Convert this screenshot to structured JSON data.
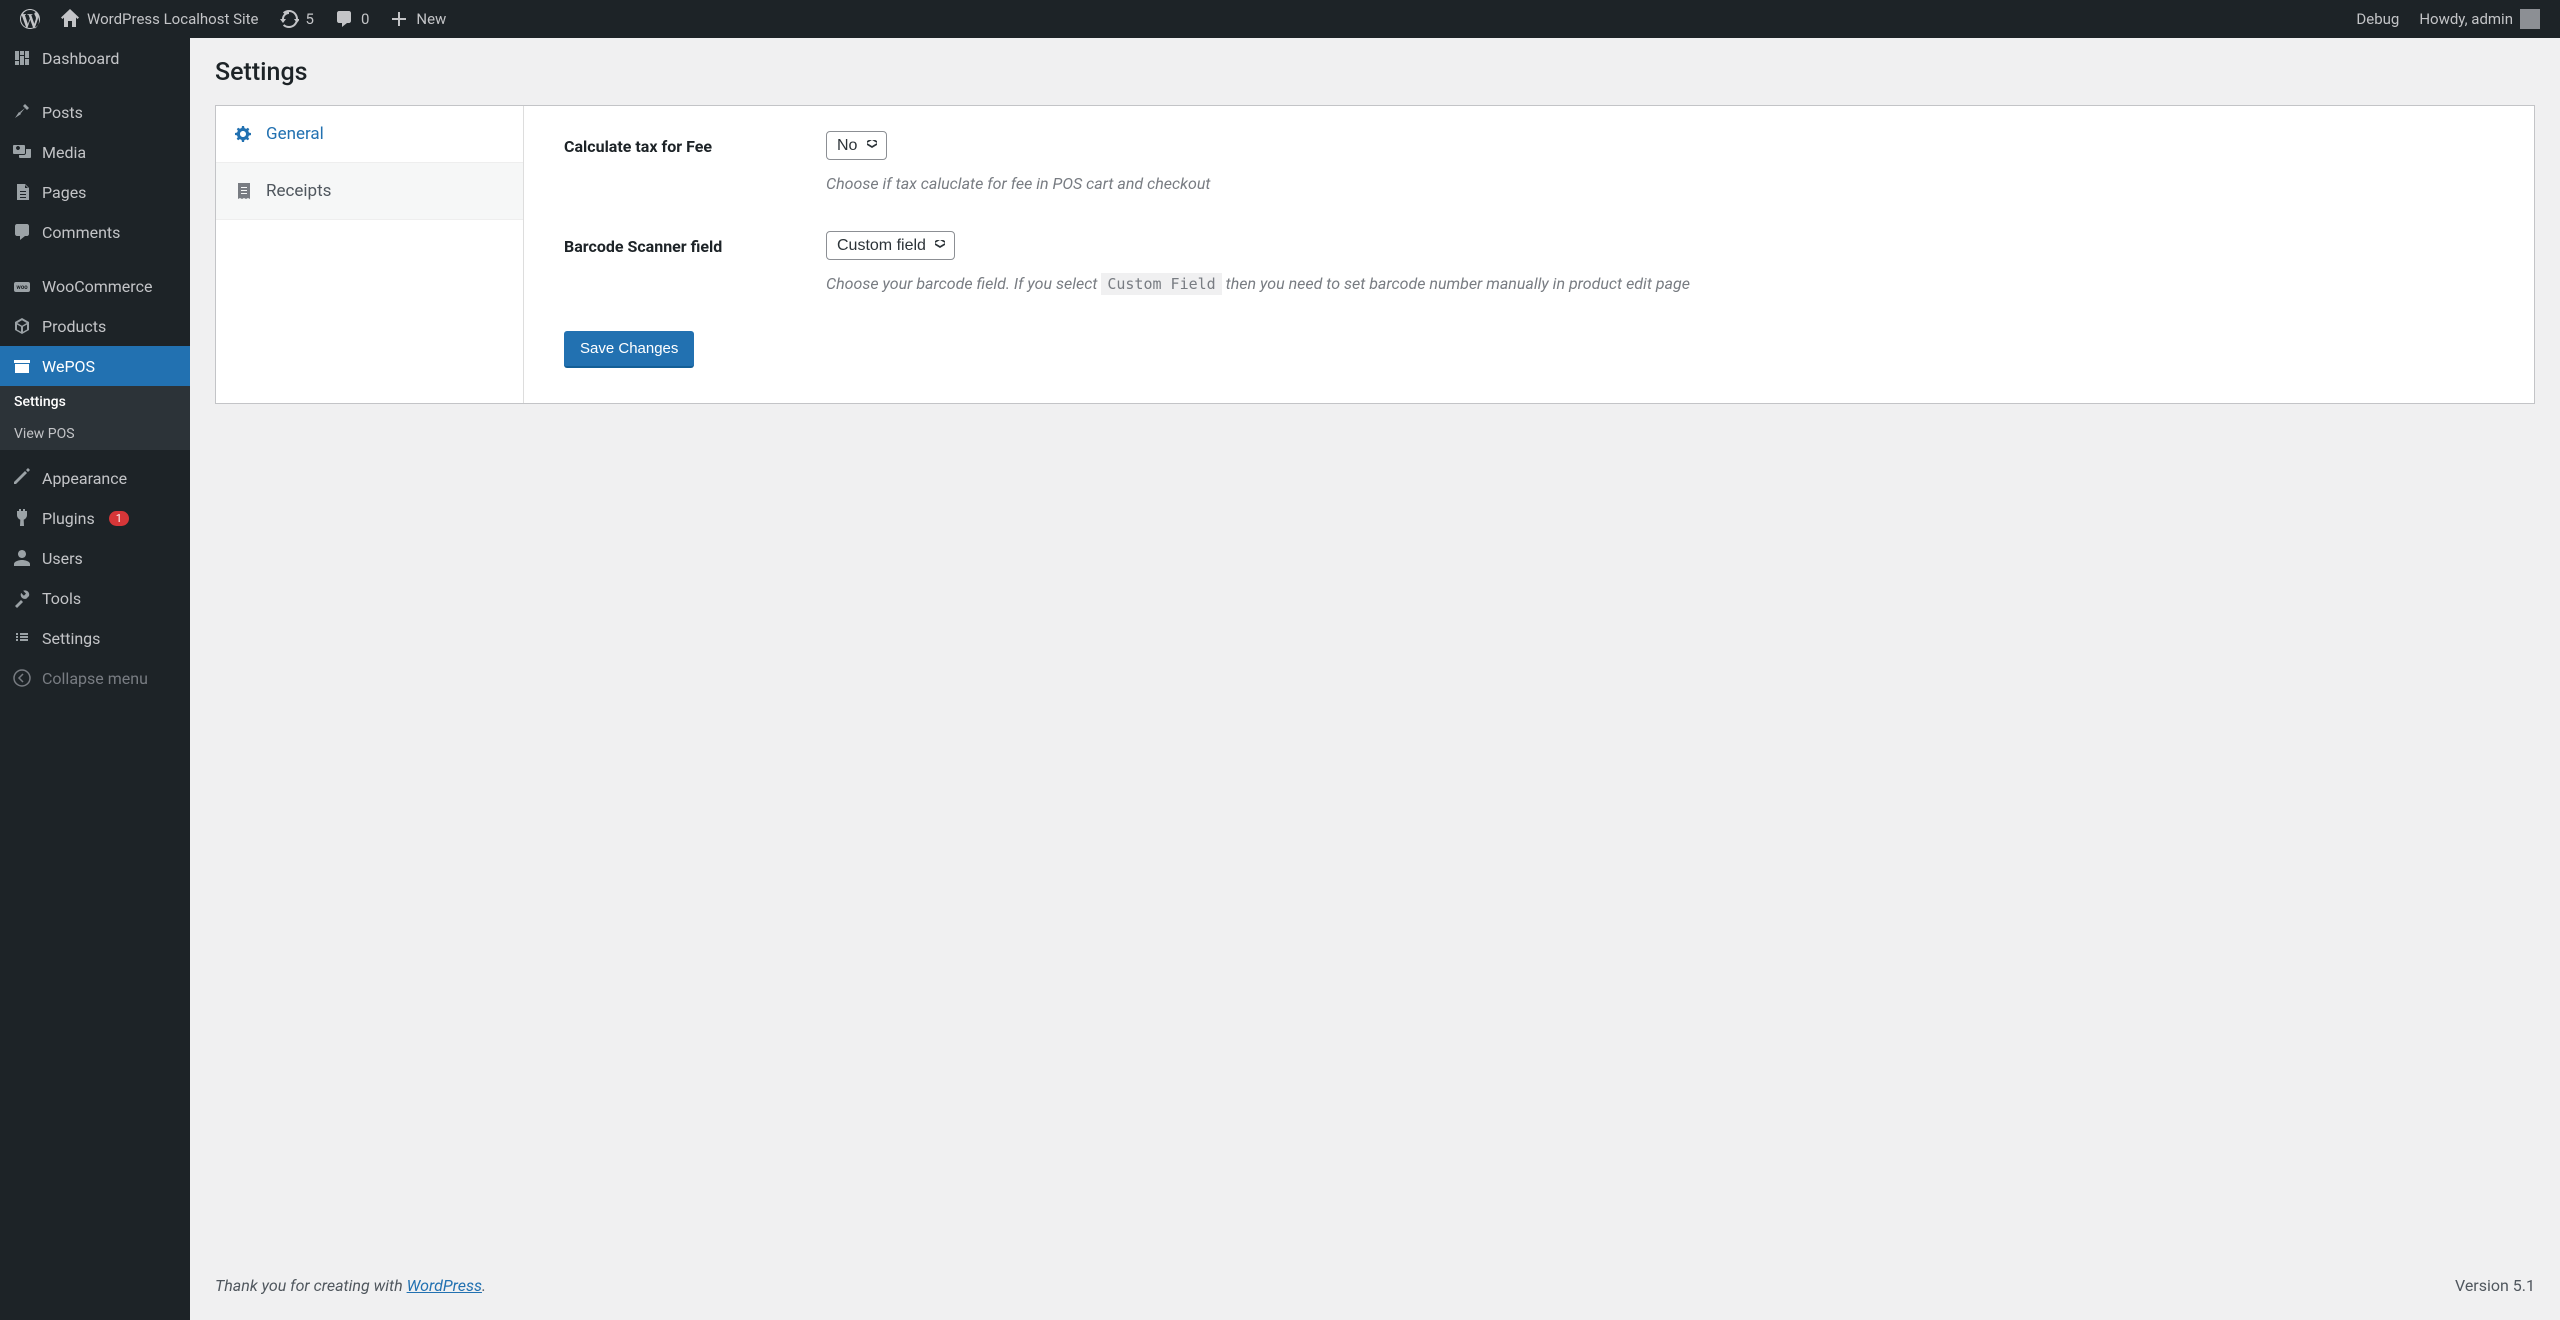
{
  "adminbar": {
    "site_name": "WordPress Localhost Site",
    "updates_count": "5",
    "comments_count": "0",
    "new_label": "New",
    "debug_label": "Debug",
    "howdy": "Howdy, admin"
  },
  "sidebar": {
    "items": [
      {
        "label": "Dashboard"
      },
      {
        "label": "Posts"
      },
      {
        "label": "Media"
      },
      {
        "label": "Pages"
      },
      {
        "label": "Comments"
      },
      {
        "label": "WooCommerce"
      },
      {
        "label": "Products"
      },
      {
        "label": "WePOS"
      },
      {
        "label": "Appearance"
      },
      {
        "label": "Plugins",
        "badge": "1"
      },
      {
        "label": "Users"
      },
      {
        "label": "Tools"
      },
      {
        "label": "Settings"
      }
    ],
    "submenu": [
      {
        "label": "Settings"
      },
      {
        "label": "View POS"
      }
    ],
    "collapse_label": "Collapse menu"
  },
  "page": {
    "title": "Settings",
    "tabs": [
      {
        "label": "General"
      },
      {
        "label": "Receipts"
      }
    ],
    "fields": {
      "tax_fee": {
        "label": "Calculate tax for Fee",
        "value": "No",
        "help": "Choose if tax caluclate for fee in POS cart and checkout"
      },
      "barcode": {
        "label": "Barcode Scanner field",
        "value": "Custom field",
        "help_pre": "Choose your barcode field. If you select ",
        "help_code": "Custom Field",
        "help_post": " then you need to set barcode number manually in product edit page"
      }
    },
    "save_label": "Save Changes"
  },
  "footer": {
    "thankyou_pre": "Thank you for creating with ",
    "wordpress_link": "WordPress",
    "thankyou_post": ".",
    "version": "Version 5.1"
  }
}
